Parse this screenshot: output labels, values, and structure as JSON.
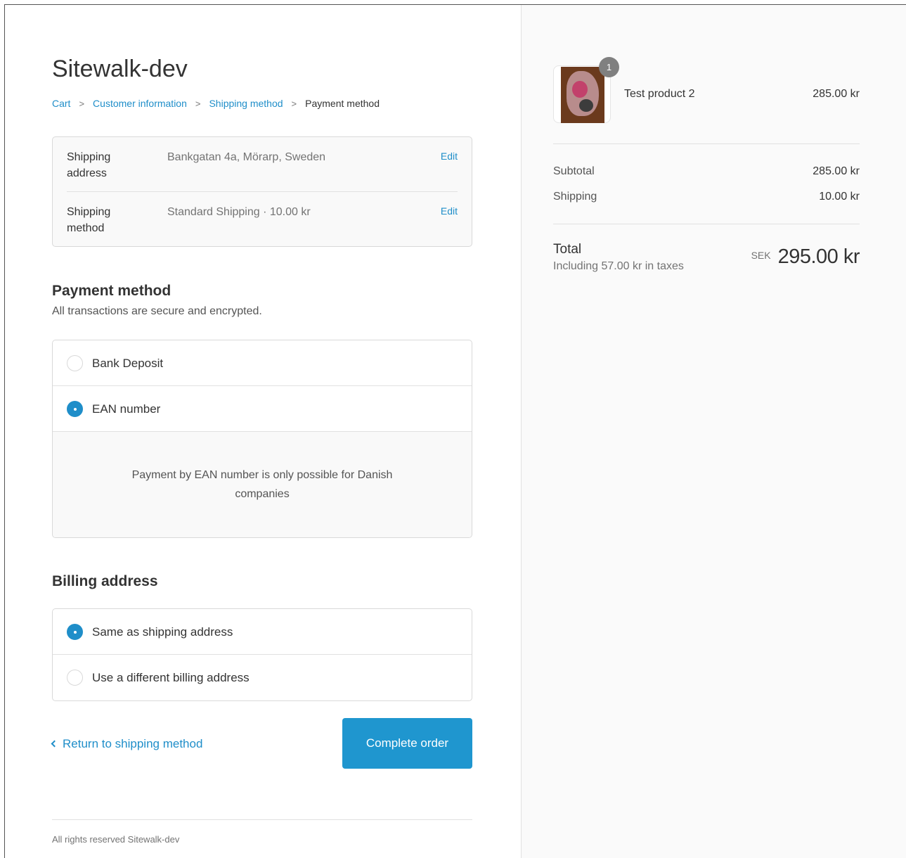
{
  "shop": {
    "title": "Sitewalk-dev"
  },
  "breadcrumb": [
    {
      "label": "Cart"
    },
    {
      "label": "Customer information"
    },
    {
      "label": "Shipping method"
    },
    {
      "label": "Payment method"
    }
  ],
  "review": {
    "rows": [
      {
        "label": "Shipping address",
        "value": "Bankgatan 4a, Mörarp, Sweden",
        "action": "Edit"
      },
      {
        "label": "Shipping method",
        "value": "Standard Shipping · 10.00 kr",
        "action": "Edit"
      }
    ]
  },
  "payment": {
    "title": "Payment method",
    "subtitle": "All transactions are secure and encrypted.",
    "options": [
      {
        "label": "Bank Deposit",
        "selected": false
      },
      {
        "label": "EAN number",
        "selected": true
      }
    ],
    "info": "Payment by EAN number is only possible for Danish companies"
  },
  "billing": {
    "title": "Billing address",
    "options": [
      {
        "label": "Same as shipping address",
        "selected": true
      },
      {
        "label": "Use a different billing address",
        "selected": false
      }
    ]
  },
  "actions": {
    "return_label": "Return to shipping method",
    "complete_label": "Complete order"
  },
  "footer": {
    "text": "All rights reserved Sitewalk-dev"
  },
  "summary": {
    "product": {
      "name": "Test product 2",
      "price": "285.00 kr",
      "quantity": "1"
    },
    "subtotal_label": "Subtotal",
    "subtotal_value": "285.00 kr",
    "shipping_label": "Shipping",
    "shipping_value": "10.00 kr",
    "total_label": "Total",
    "tax_note": "Including 57.00 kr in taxes",
    "currency": "SEK",
    "total_value": "295.00 kr"
  },
  "colors": {
    "accent": "#1f96cf",
    "link": "#1f8ec9",
    "sidebar_bg": "#fafafa"
  }
}
